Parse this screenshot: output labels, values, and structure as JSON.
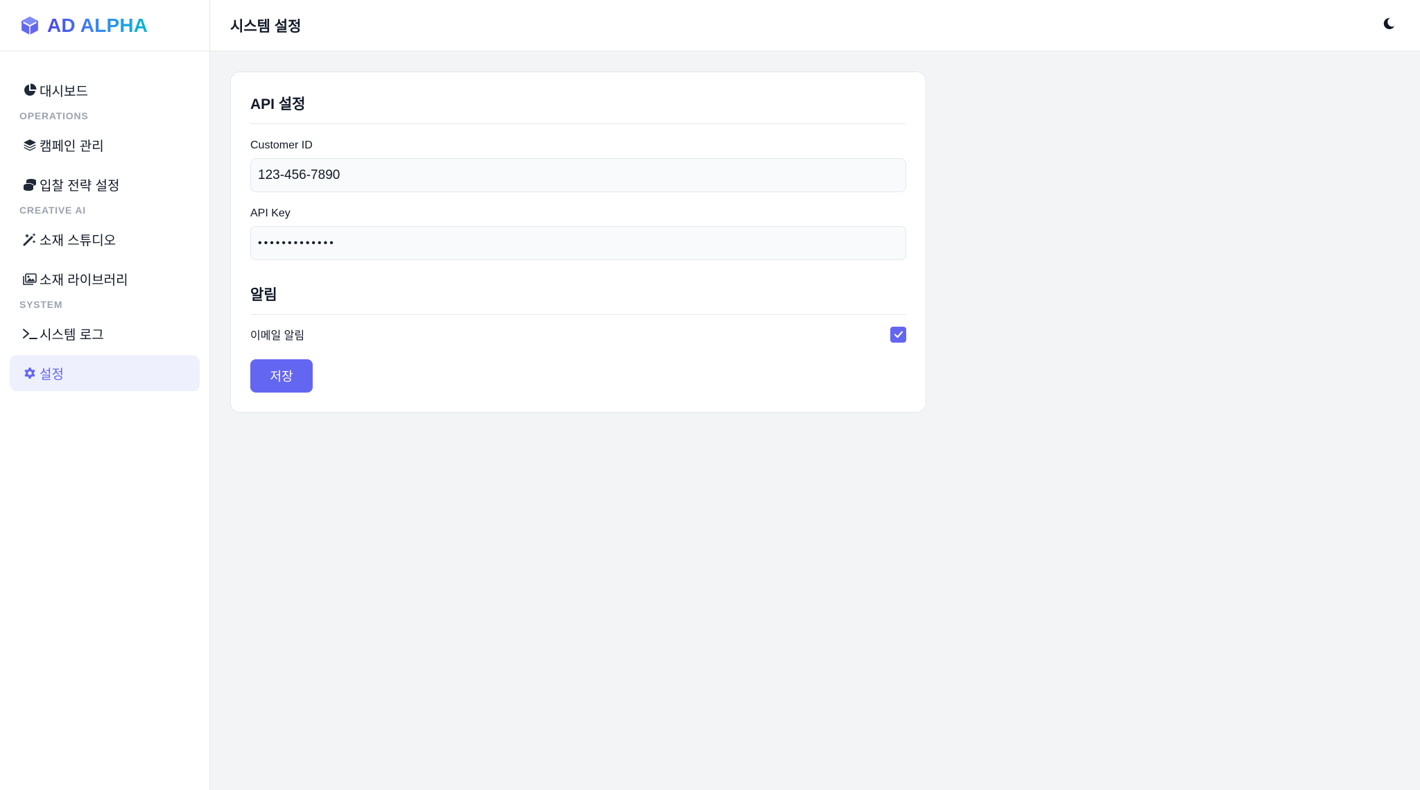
{
  "brand": {
    "name": "AD ALPHA",
    "icon": "cube-icon"
  },
  "sidebar": {
    "items": [
      {
        "type": "item",
        "label": "대시보드",
        "icon": "pie-chart-icon"
      },
      {
        "type": "section",
        "label": "OPERATIONS"
      },
      {
        "type": "item",
        "label": "캠페인 관리",
        "icon": "layers-icon"
      },
      {
        "type": "item",
        "label": "입찰 전략 설정",
        "icon": "coins-icon"
      },
      {
        "type": "section",
        "label": "CREATIVE AI"
      },
      {
        "type": "item",
        "label": "소재 스튜디오",
        "icon": "magic-wand-icon"
      },
      {
        "type": "item",
        "label": "소재 라이브러리",
        "icon": "images-icon"
      },
      {
        "type": "section",
        "label": "SYSTEM"
      },
      {
        "type": "item",
        "label": "시스템 로그",
        "icon": "terminal-icon"
      },
      {
        "type": "item",
        "label": "설정",
        "icon": "gear-icon",
        "active": true
      }
    ]
  },
  "header": {
    "title": "시스템 설정",
    "theme_icon": "moon-icon"
  },
  "settings": {
    "api_section_title": "API 설정",
    "customer_id": {
      "label": "Customer ID",
      "value": "123-456-7890"
    },
    "api_key": {
      "label": "API Key",
      "value": "•••••••••••••"
    },
    "notify_section_title": "알림",
    "email_notify": {
      "label": "이메일 알림",
      "checked": true
    },
    "save_label": "저장"
  },
  "colors": {
    "accent": "#6366f1",
    "active_bg": "#eef0fd",
    "page_bg": "#f3f4f6"
  }
}
